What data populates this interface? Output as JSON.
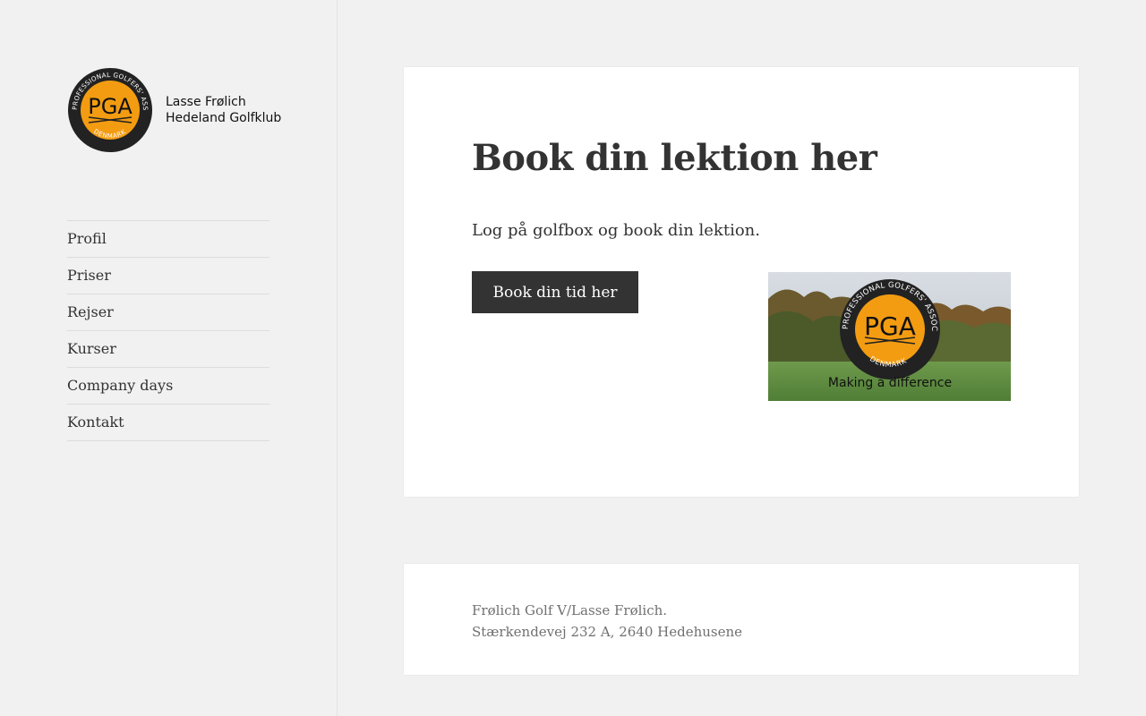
{
  "site": {
    "logo": {
      "badge_text": "PGA",
      "badge_ring_text": "PROFESSIONAL GOLFERS' ASSOCIATION",
      "badge_bottom_text": "DENMARK",
      "line1": "Lasse Frølich",
      "line2": "Hedeland Golfklub",
      "badge_color": "#f39c12"
    },
    "nav": {
      "items": [
        {
          "label": "Profil"
        },
        {
          "label": "Priser"
        },
        {
          "label": "Rejser"
        },
        {
          "label": "Kurser"
        },
        {
          "label": "Company days"
        },
        {
          "label": "Kontakt"
        }
      ]
    }
  },
  "main": {
    "title": "Book din lektion her",
    "intro": "Log på golfbox og book din lektion.",
    "book_button": "Book din tid her",
    "banner": {
      "badge_text": "PGA",
      "ring_text": "PROFESSIONAL GOLFERS' ASSOCIATION",
      "bottom_text": "DENMARK",
      "caption": "Making a difference"
    }
  },
  "footer": {
    "line1": "Frølich Golf V/Lasse Frølich.",
    "line2": "Stærkendevej 232 A, 2640 Hedehusene"
  },
  "colors": {
    "background": "#f1f1f1",
    "button": "#333333",
    "accent_orange": "#f39c12"
  }
}
